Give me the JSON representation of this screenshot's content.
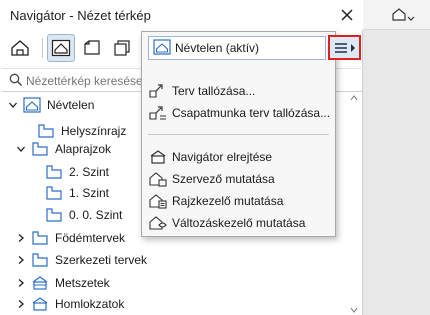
{
  "window": {
    "title": "Navigátor - Nézet térkép",
    "close_icon": "close-icon"
  },
  "toolbar": {
    "buttons": [
      {
        "name": "project-map-icon"
      },
      {
        "name": "view-map-icon",
        "active": true
      },
      {
        "name": "layout-book-icon"
      },
      {
        "name": "publisher-sets-icon"
      }
    ]
  },
  "search": {
    "placeholder": "Nézettérkép keresése"
  },
  "tree": {
    "items": [
      {
        "label": "Névtelen",
        "expander": "down",
        "icon": "view-map-icon"
      },
      {
        "label": "Helyszínrajz",
        "expander": "",
        "icon": "folder-icon"
      },
      {
        "label": "Alaprajzok",
        "expander": "down",
        "icon": "folder-icon"
      },
      {
        "label": "2. Szint",
        "expander": "",
        "icon": "view-folder-icon"
      },
      {
        "label": "1. Szint",
        "expander": "",
        "icon": "view-folder-icon"
      },
      {
        "label": "0. 0. Szint",
        "expander": "",
        "icon": "view-folder-icon"
      },
      {
        "label": "Födémtervek",
        "expander": "right",
        "icon": "folder-icon"
      },
      {
        "label": "Szerkezeti tervek",
        "expander": "right",
        "icon": "folder-icon"
      },
      {
        "label": "Metszetek",
        "expander": "right",
        "icon": "section-icon"
      },
      {
        "label": "Homlokzatok",
        "expander": "right",
        "icon": "elevation-icon"
      }
    ]
  },
  "popup": {
    "selected": "Névtelen (aktív)",
    "menu_icon": "menu-icon",
    "items": [
      {
        "label": "Terv tallózása...",
        "icon": "browse-icon"
      },
      {
        "label": "Csapatmunka terv tallózása...",
        "icon": "teamwork-browse-icon"
      },
      {
        "label": "Navigátor elrejtése",
        "icon": "hide-navigator-icon"
      },
      {
        "label": "Szervező mutatása",
        "icon": "organizer-icon"
      },
      {
        "label": "Rajzkezelő mutatása",
        "icon": "drawing-manager-icon"
      },
      {
        "label": "Változáskezelő mutatása",
        "icon": "change-manager-icon"
      }
    ]
  },
  "colors": {
    "accent": "#2b6fc6",
    "highlight_border": "#e0201e"
  }
}
